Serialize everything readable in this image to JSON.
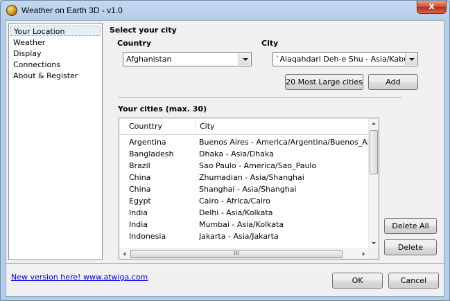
{
  "window": {
    "title": "Weather on Earth 3D - v1.0",
    "close_glyph": "x"
  },
  "nav": {
    "items": [
      {
        "label": "Your Location",
        "selected": true
      },
      {
        "label": "Weather"
      },
      {
        "label": "Display"
      },
      {
        "label": "Connections"
      },
      {
        "label": "About & Register"
      }
    ]
  },
  "location": {
    "section_title": "Select your city",
    "country_label": "Country",
    "country_value": "Afghanistan",
    "city_label": "City",
    "city_value": "`Alaqahdari Deh-e Shu - Asia/Kabul",
    "large_cities_button": "20 Most Large cities",
    "add_button": "Add"
  },
  "cities": {
    "section_title": "Your cities (max. 30)",
    "columns": [
      "Counttry",
      "City"
    ],
    "rows": [
      {
        "country": "Argentina",
        "city": "Buenos Aires - America/Argentina/Buenos_Aires"
      },
      {
        "country": "Bangladesh",
        "city": "Dhaka - Asia/Dhaka"
      },
      {
        "country": "Brazil",
        "city": "Sao Paulo - America/Sao_Paulo"
      },
      {
        "country": "China",
        "city": "Zhumadian - Asia/Shanghai"
      },
      {
        "country": "China",
        "city": "Shanghai - Asia/Shanghai"
      },
      {
        "country": "Egypt",
        "city": "Cairo - Africa/Cairo"
      },
      {
        "country": "India",
        "city": "Delhi - Asia/Kolkata"
      },
      {
        "country": "India",
        "city": "Mumbai - Asia/Kolkata"
      },
      {
        "country": "Indonesia",
        "city": "Jakarta - Asia/Jakarta"
      }
    ],
    "hscroll_grip": "III",
    "delete_all_button": "Delete All",
    "delete_button": "Delete"
  },
  "footer": {
    "link_text": "New version here! www.atwiga.com",
    "ok_button": "OK",
    "cancel_button": "Cancel"
  }
}
